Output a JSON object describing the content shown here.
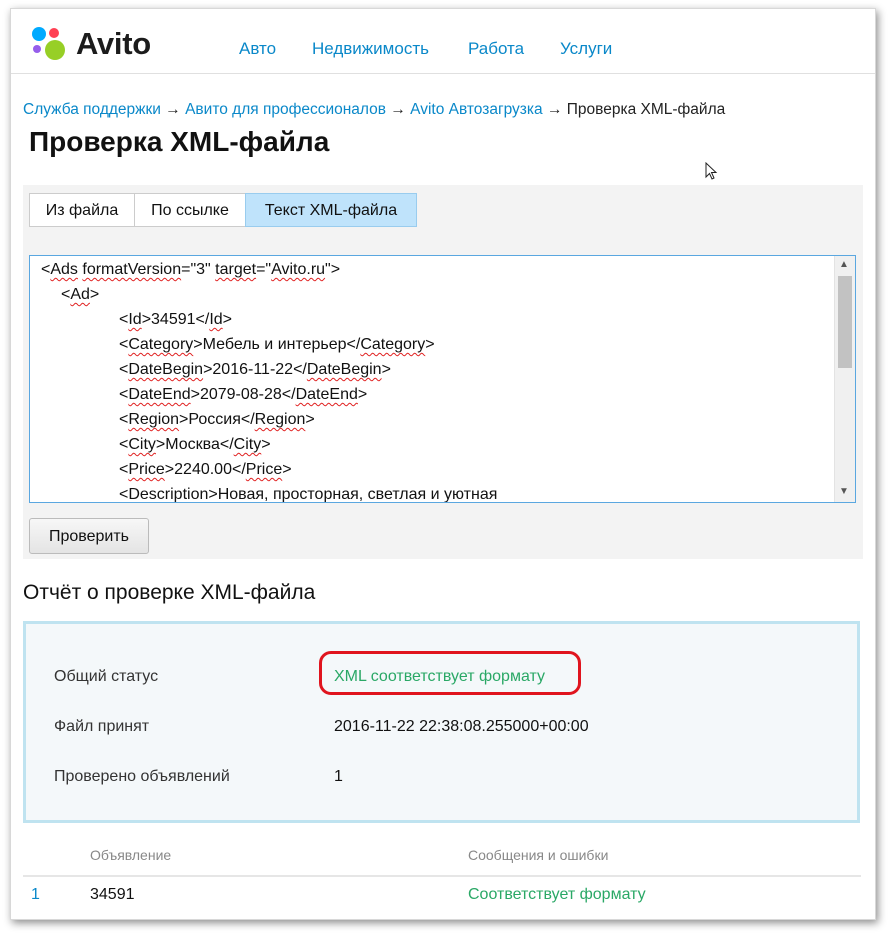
{
  "brand": {
    "name": "Avito",
    "dot_colors": [
      "#00aaff",
      "#ff4053",
      "#965eeb",
      "#97cf26"
    ]
  },
  "nav": {
    "items": [
      {
        "label": "Авто"
      },
      {
        "label": "Недвижимость"
      },
      {
        "label": "Работа"
      },
      {
        "label": "Услуги"
      }
    ]
  },
  "breadcrumbs": {
    "items": [
      {
        "label": "Служба поддержки"
      },
      {
        "label": "Авито для профессионалов"
      },
      {
        "label": "Avito Автозагрузка"
      }
    ],
    "current": "Проверка XML-файла",
    "separator": "→"
  },
  "page": {
    "title": "Проверка XML-файла"
  },
  "tabs": [
    {
      "label": "Из файла"
    },
    {
      "label": "По ссылке"
    },
    {
      "label": "Текст XML-файла"
    }
  ],
  "editor": {
    "lines": [
      "<Ads formatVersion=\"3\" target=\"Avito.ru\">",
      "<Ad>",
      "<Id>34591</Id>",
      "<Category>Мебель и интерьер</Category>",
      "<DateBegin>2016-11-22</DateBegin>",
      "<DateEnd>2079-08-28</DateEnd>",
      "<Region>Россия</Region>",
      "<City>Москва</City>",
      "<Price>2240.00</Price>",
      "<Description>Новая, просторная, светлая и уютная"
    ]
  },
  "actions": {
    "check_label": "Проверить"
  },
  "report": {
    "title": "Отчёт о проверке XML-файла",
    "status_label": "Общий статус",
    "status_value": "XML соответствует формату",
    "accepted_label": "Файл принят",
    "accepted_value": "2016-11-22 22:38:08.255000+00:00",
    "checked_label": "Проверено объявлений",
    "checked_value": "1"
  },
  "results": {
    "columns": [
      "Объявление",
      "Сообщения и ошибки"
    ],
    "rows": [
      {
        "index": "1",
        "ad": "34591",
        "message": "Соответствует формату"
      }
    ]
  },
  "colors": {
    "link": "#0a88c9",
    "success": "#2aa866",
    "highlight": "#e0141e",
    "active_tab": "#bfe3fb"
  }
}
